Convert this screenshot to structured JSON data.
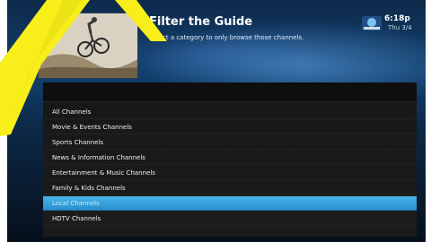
{
  "header": {
    "title": "Filter the Guide",
    "subtitle": "Select a category to only browse those channels.",
    "thumbnail_icon": "bmx-rider-thumbnail"
  },
  "status": {
    "brand_icon": "directv-logo-icon",
    "time": "6:18p",
    "date": "Thu 3/4"
  },
  "menu": {
    "items": [
      {
        "label": "All Channels"
      },
      {
        "label": "Movie & Events Channels"
      },
      {
        "label": "Sports Channels"
      },
      {
        "label": "News & Information Channels"
      },
      {
        "label": "Entertainment & Music Channels"
      },
      {
        "label": "Family & Kids Channels"
      },
      {
        "label": "Local Channels",
        "selected": true
      },
      {
        "label": "HDTV Channels"
      }
    ]
  },
  "colors": {
    "selected": "#2f9bdb",
    "annotation": "#f7ee1a",
    "background": "#0c2745"
  }
}
